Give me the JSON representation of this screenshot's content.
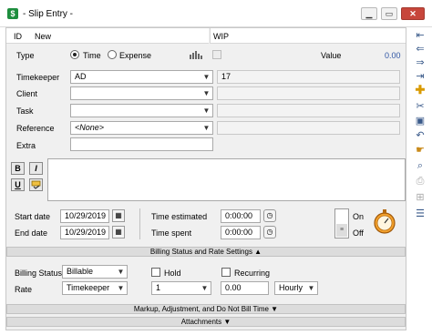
{
  "window": {
    "title": "- Slip Entry -",
    "app_icon": "$",
    "min": "▁",
    "max": "▭",
    "close": "✕"
  },
  "header": {
    "id_label": "ID",
    "id_value": "New",
    "wip_label": "WIP",
    "value_label": "Value",
    "value": "0.00"
  },
  "type": {
    "label": "Type",
    "time": "Time",
    "expense": "Expense",
    "selected": "Time"
  },
  "timekeeper": {
    "label": "Timekeeper",
    "value": "AD",
    "code": "17"
  },
  "client": {
    "label": "Client",
    "value": ""
  },
  "task": {
    "label": "Task",
    "value": ""
  },
  "reference": {
    "label": "Reference",
    "value": "<None>"
  },
  "extra": {
    "label": "Extra",
    "value": ""
  },
  "format_buttons": {
    "bold": "B",
    "italic": "I",
    "underline": "U"
  },
  "dates": {
    "start_label": "Start date",
    "start_value": "10/29/2019",
    "end_label": "End date",
    "end_value": "10/29/2019"
  },
  "times": {
    "estimated_label": "Time estimated",
    "estimated_value": "0:00:00",
    "spent_label": "Time spent",
    "spent_value": "0:00:00"
  },
  "timer": {
    "on": "On",
    "off": "Off",
    "state": "off"
  },
  "sections": {
    "billing": "Billing Status and Rate Settings ▲",
    "markup": "Markup, Adjustment, and Do Not Bill Time ▼",
    "attachments": "Attachments ▼"
  },
  "billing": {
    "status_label": "Billing Status",
    "status_value": "Billable",
    "hold": "Hold",
    "recurring": "Recurring",
    "rate_label": "Rate",
    "rate_source": "Timekeeper",
    "rate_level": "1",
    "rate_amount": "0.00",
    "rate_unit": "Hourly"
  },
  "colors": {
    "accent_blue": "#2f55a4",
    "close_red": "#c7463b",
    "frame_gray": "#f0f0f0"
  }
}
